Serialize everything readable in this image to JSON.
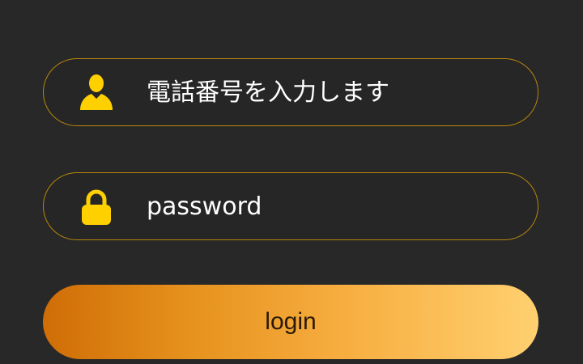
{
  "form": {
    "phone": {
      "placeholder": "電話番号を入力します",
      "icon": "user-icon"
    },
    "password": {
      "placeholder": "password",
      "icon": "lock-icon"
    },
    "login_label": "login"
  },
  "colors": {
    "background": "#282828",
    "field_border": "#b8860b",
    "icon": "#ffd000",
    "button_gradient_start": "#cf6d06",
    "button_gradient_end": "#ffd070"
  }
}
